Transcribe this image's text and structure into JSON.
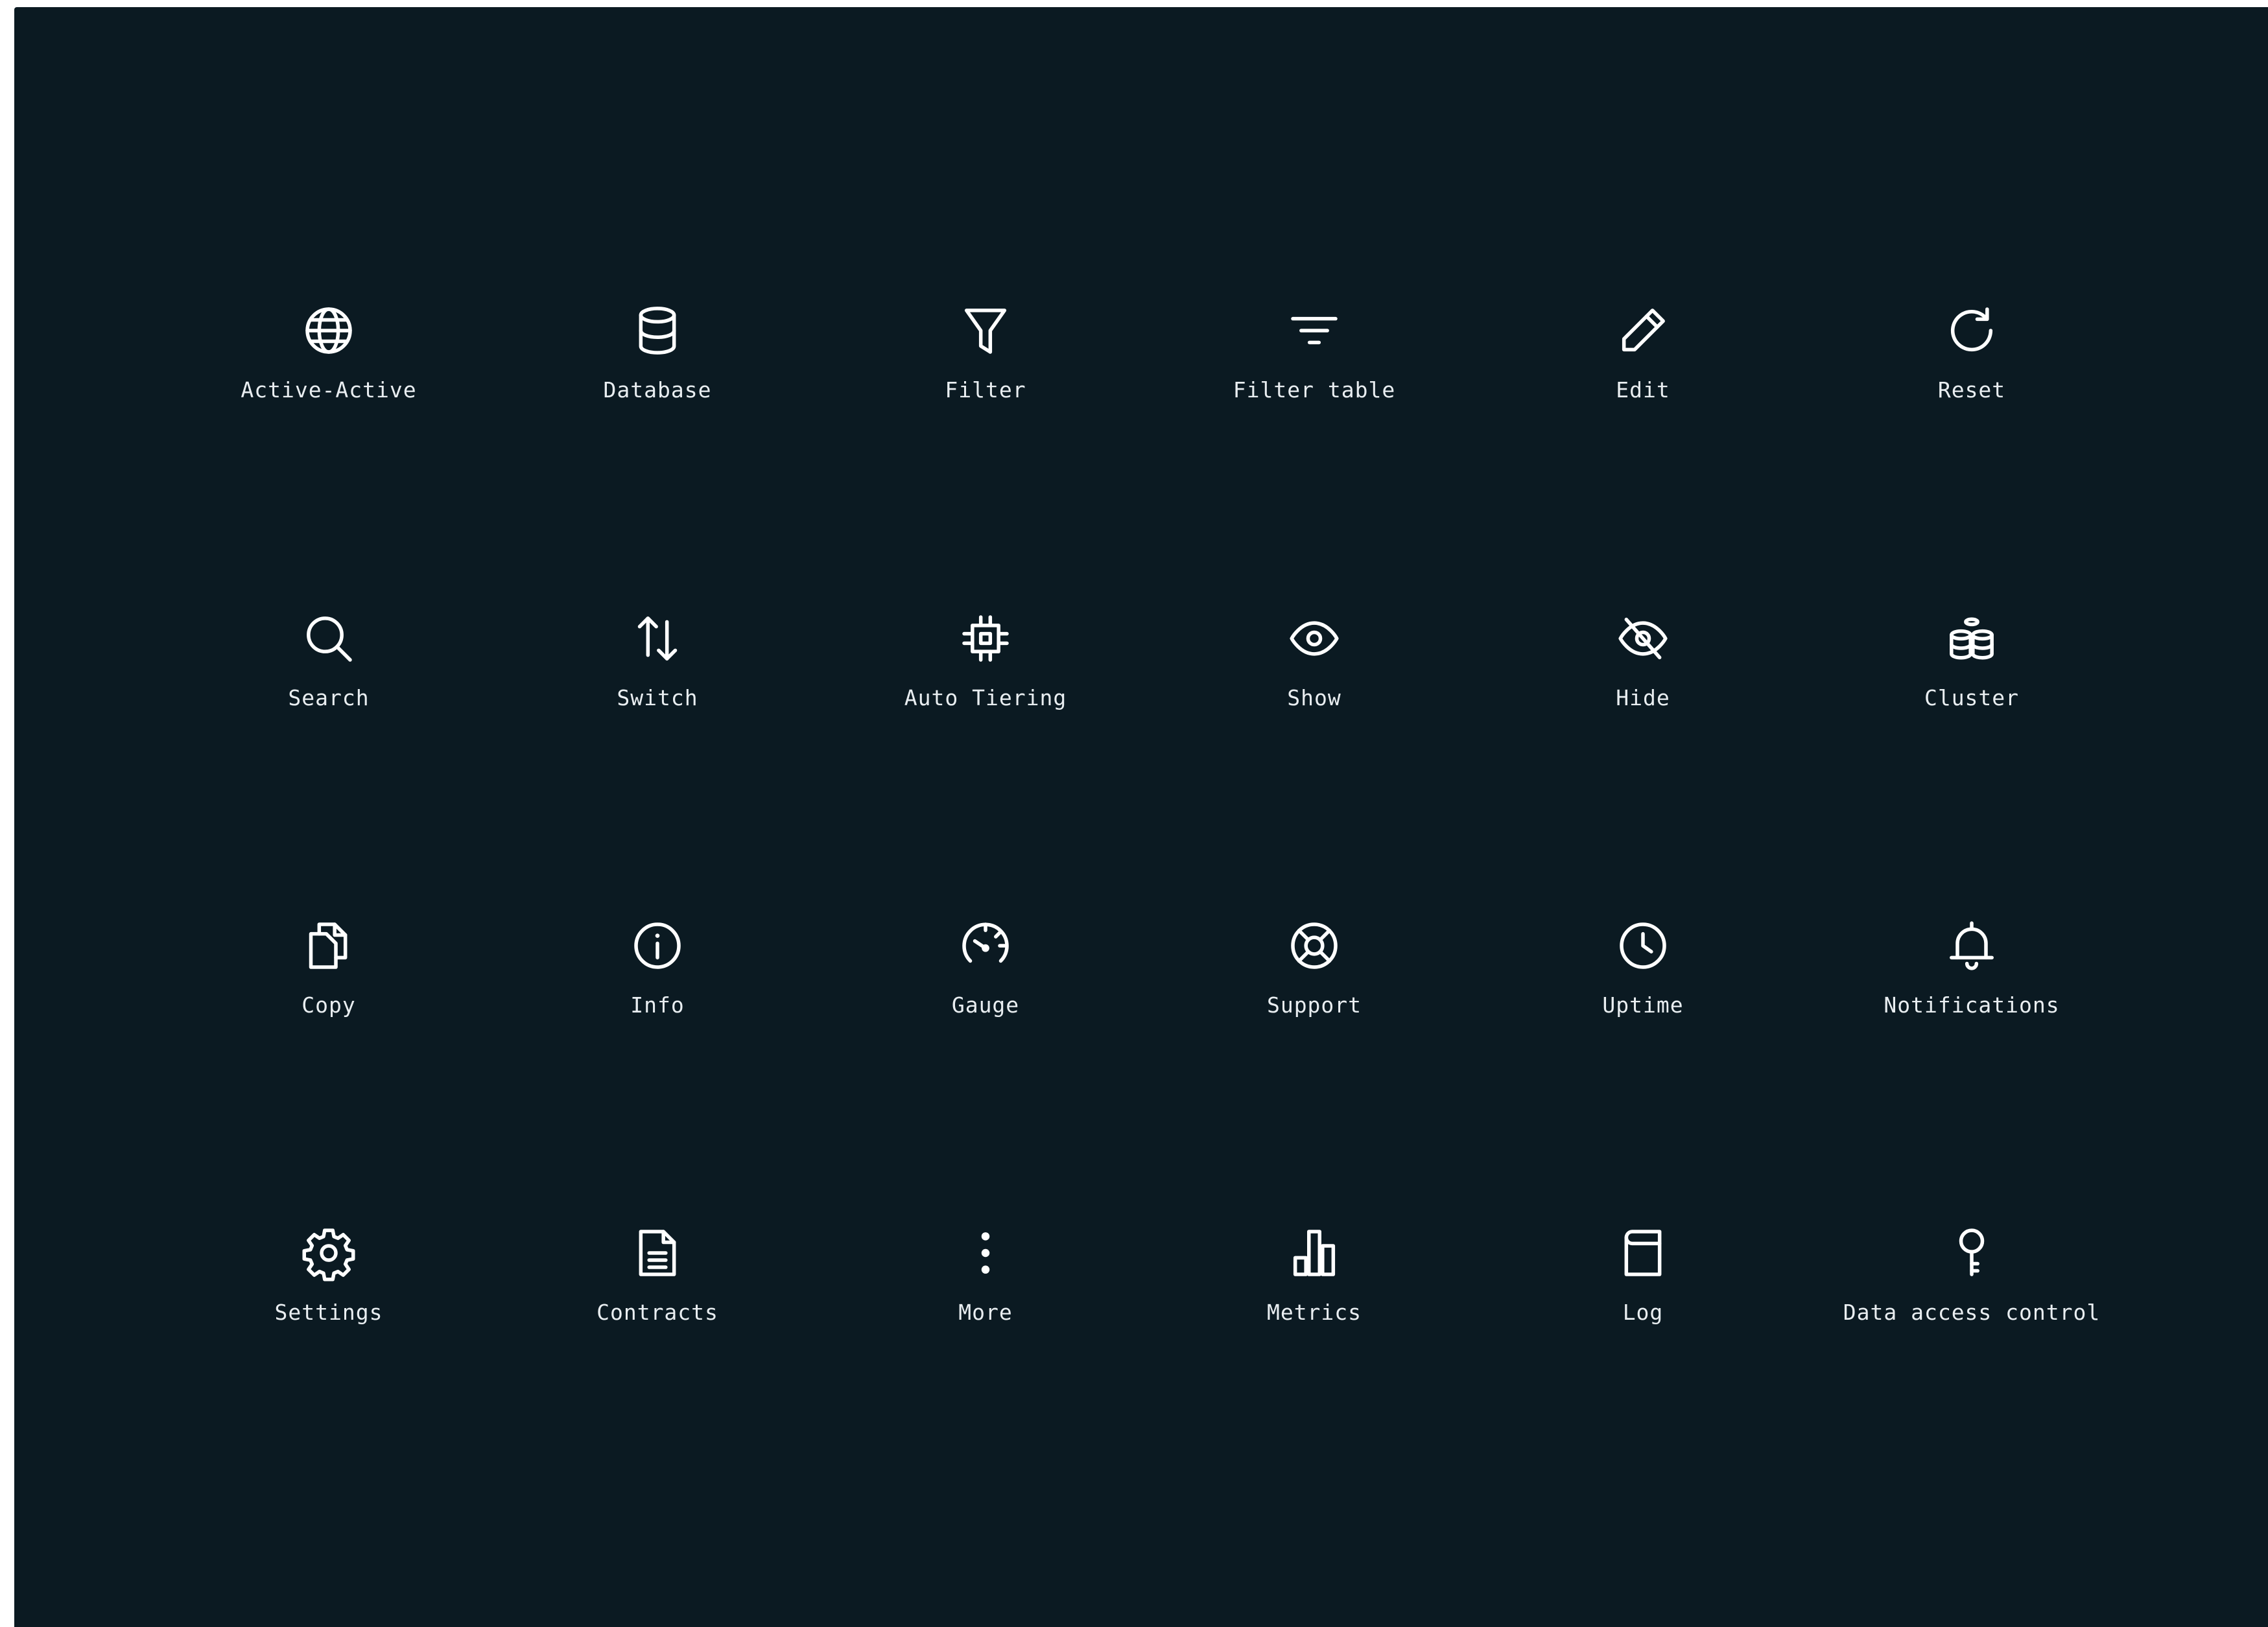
{
  "colors": {
    "background": "#0b1a22",
    "icon": "#ffffff",
    "label": "#e9eef1"
  },
  "icons": [
    {
      "label": "Active-Active",
      "icon": "globe-icon"
    },
    {
      "label": "Database",
      "icon": "database-icon"
    },
    {
      "label": "Filter",
      "icon": "funnel-icon"
    },
    {
      "label": "Filter table",
      "icon": "filter-lines-icon"
    },
    {
      "label": "Edit",
      "icon": "pencil-icon"
    },
    {
      "label": "Reset",
      "icon": "rotate-cw-icon"
    },
    {
      "label": "Search",
      "icon": "magnifier-icon"
    },
    {
      "label": "Switch",
      "icon": "arrows-up-down-icon"
    },
    {
      "label": "Auto Tiering",
      "icon": "chip-icon"
    },
    {
      "label": "Show",
      "icon": "eye-icon"
    },
    {
      "label": "Hide",
      "icon": "eye-off-icon"
    },
    {
      "label": "Cluster",
      "icon": "database-cluster-icon"
    },
    {
      "label": "Copy",
      "icon": "copy-icon"
    },
    {
      "label": "Info",
      "icon": "info-icon"
    },
    {
      "label": "Gauge",
      "icon": "gauge-icon"
    },
    {
      "label": "Support",
      "icon": "life-buoy-icon"
    },
    {
      "label": "Uptime",
      "icon": "clock-icon"
    },
    {
      "label": "Notifications",
      "icon": "bell-icon"
    },
    {
      "label": "Settings",
      "icon": "gear-icon"
    },
    {
      "label": "Contracts",
      "icon": "document-icon"
    },
    {
      "label": "More",
      "icon": "more-vertical-icon"
    },
    {
      "label": "Metrics",
      "icon": "bar-chart-icon"
    },
    {
      "label": "Log",
      "icon": "log-icon"
    },
    {
      "label": "Data access control",
      "icon": "key-icon"
    }
  ]
}
